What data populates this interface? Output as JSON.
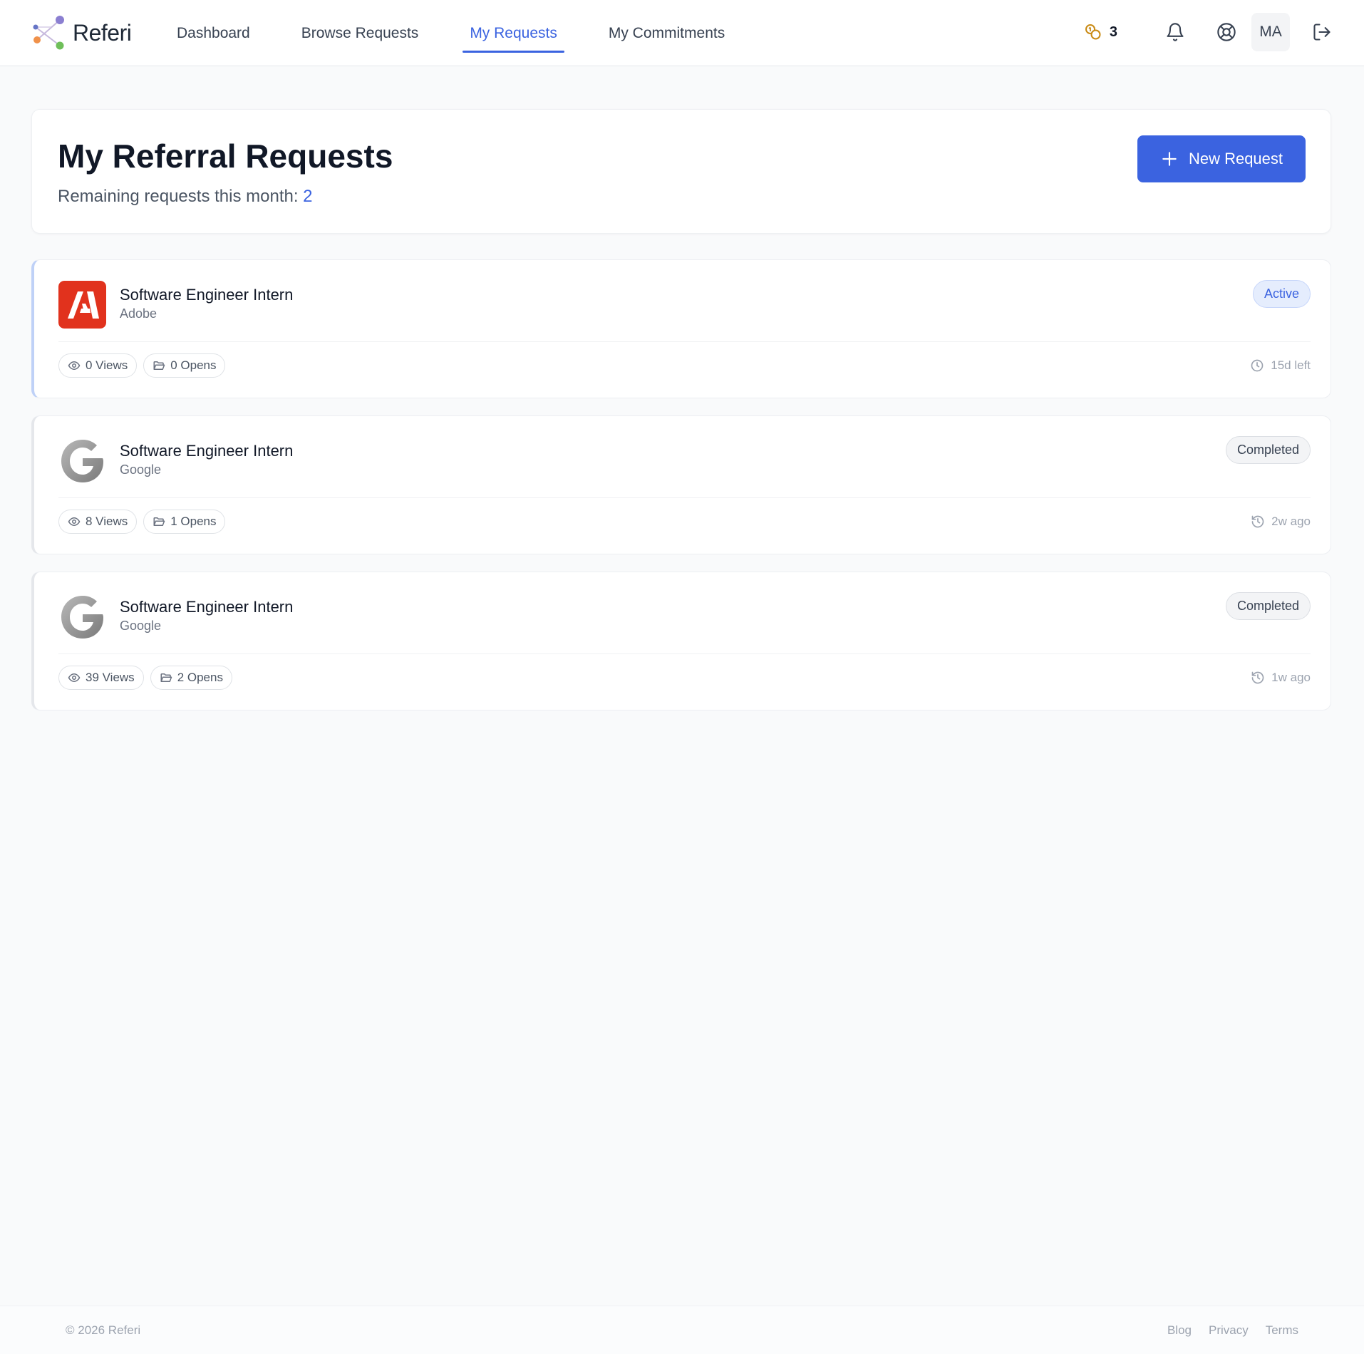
{
  "app": {
    "name": "Referi"
  },
  "nav": {
    "items": [
      {
        "label": "Dashboard",
        "active": false
      },
      {
        "label": "Browse Requests",
        "active": false
      },
      {
        "label": "My Requests",
        "active": true
      },
      {
        "label": "My Commitments",
        "active": false
      }
    ]
  },
  "header": {
    "credits_count": "3",
    "credits_icon": "coins-icon",
    "notification_icon": "bell-icon",
    "help_icon": "life-buoy-icon",
    "avatar_initials": "MA",
    "logout_icon": "logout-icon"
  },
  "page": {
    "title": "My Referral Requests",
    "remaining_label": "Remaining requests this month:",
    "remaining_count": "2",
    "new_request_label": "New Request"
  },
  "requests": [
    {
      "title": "Software Engineer Intern",
      "company": "Adobe",
      "logo": "adobe-logo",
      "status": "Active",
      "views": "0 Views",
      "opens": "0 Opens",
      "time": "15d left",
      "time_icon": "clock-icon"
    },
    {
      "title": "Software Engineer Intern",
      "company": "Google",
      "logo": "google-logo",
      "status": "Completed",
      "views": "8 Views",
      "opens": "1 Opens",
      "time": "2w ago",
      "time_icon": "history-icon"
    },
    {
      "title": "Software Engineer Intern",
      "company": "Google",
      "logo": "google-logo",
      "status": "Completed",
      "views": "39 Views",
      "opens": "2 Opens",
      "time": "1w ago",
      "time_icon": "history-icon"
    }
  ],
  "footer": {
    "copyright": "© 2026 Referi",
    "links": [
      "Blog",
      "Privacy",
      "Terms"
    ]
  },
  "colors": {
    "accent": "#3b63e0",
    "adobe_red": "#e1321d",
    "background": "#f9fafb"
  }
}
